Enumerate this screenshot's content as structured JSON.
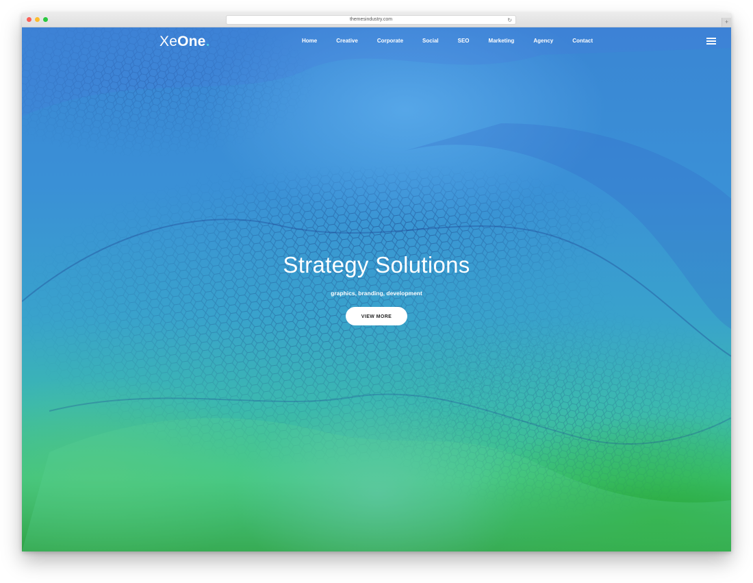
{
  "browser": {
    "url": "themesindustry.com",
    "reload_icon": "reload-icon",
    "new_tab_icon": "plus-icon",
    "new_tab_glyph": "+",
    "reload_glyph": "↻"
  },
  "header": {
    "logo_part1": "Xe",
    "logo_part2": "One",
    "nav": [
      {
        "label": "Home"
      },
      {
        "label": "Creative"
      },
      {
        "label": "Corporate"
      },
      {
        "label": "Social"
      },
      {
        "label": "SEO"
      },
      {
        "label": "Marketing"
      },
      {
        "label": "Agency"
      },
      {
        "label": "Contact"
      }
    ],
    "menu_icon": "hamburger-icon"
  },
  "hero": {
    "title": "Strategy Solutions",
    "subtitle": "graphics, branding, development",
    "cta_label": "VIEW MORE"
  },
  "colors": {
    "accent_dot": "#4fd3e8",
    "hero_top": "#3a86d4",
    "hero_bottom": "#2c9e3e"
  }
}
